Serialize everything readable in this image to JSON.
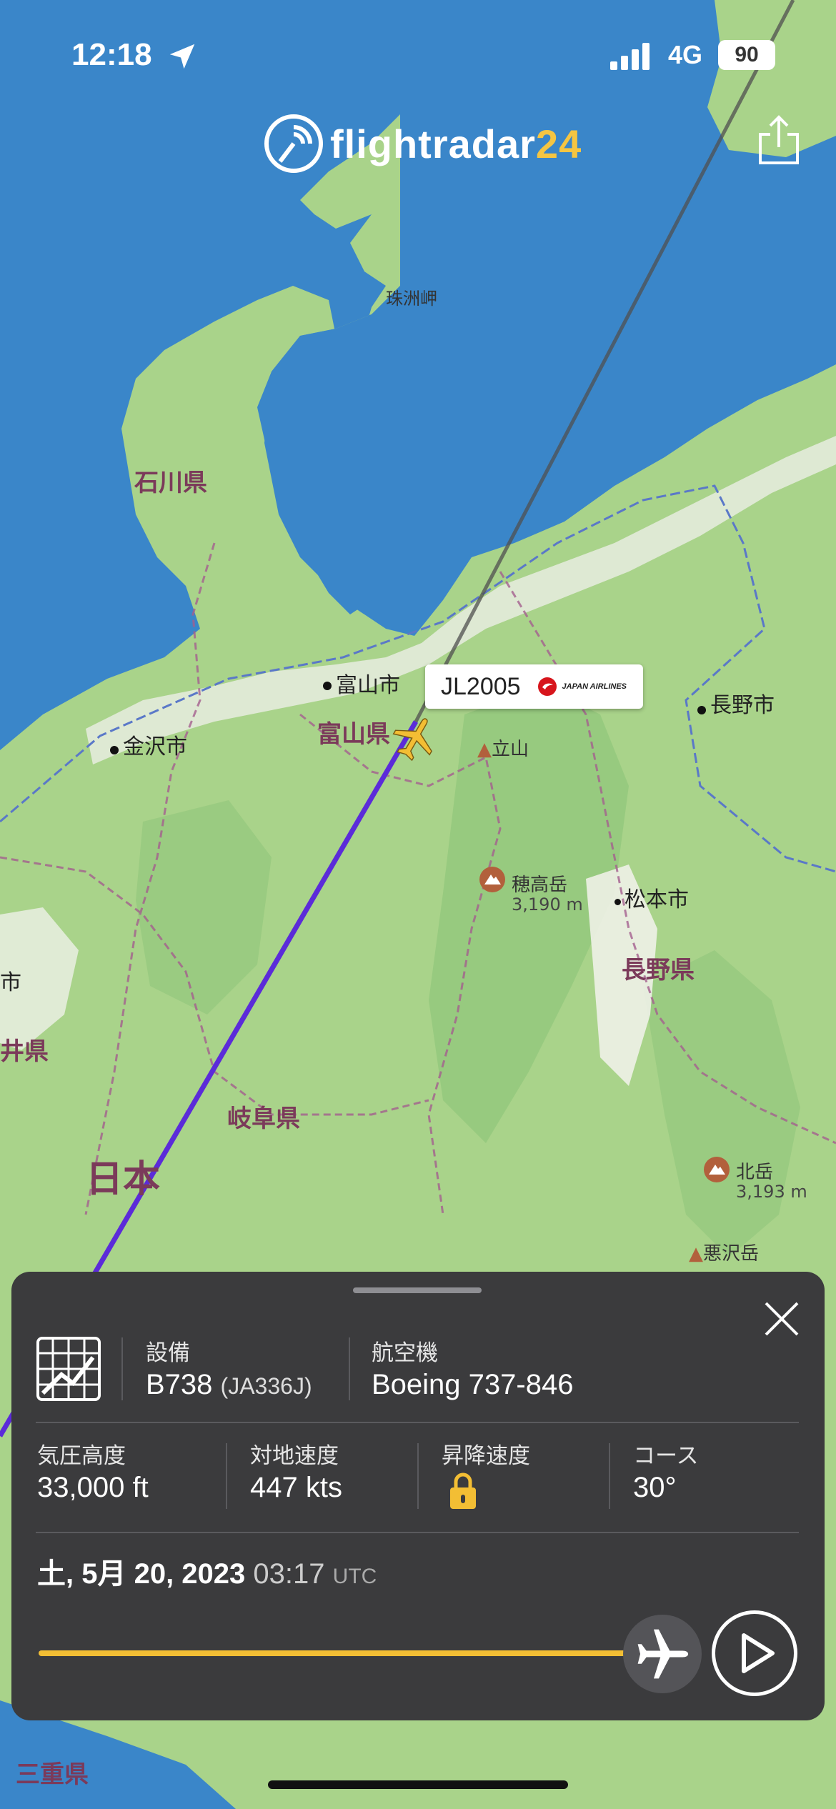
{
  "status_bar": {
    "time": "12:18",
    "network": "4G",
    "battery": "90"
  },
  "brand": {
    "name": "flightradar",
    "suffix": "24"
  },
  "map": {
    "labels": {
      "suzu": "珠洲岬",
      "ishikawa": "石川県",
      "toyama_city": "富山市",
      "toyama_pref": "富山県",
      "kanazawa": "金沢市",
      "tateyama": "立山",
      "nagano_city": "長野市",
      "hotaka": "穂高岳",
      "hotaka_elev": "3,190 m",
      "matsumoto": "松本市",
      "nagano_pref": "長野県",
      "fukui_city": "市",
      "fukui_pref": "井県",
      "gifu": "岐阜県",
      "japan": "日本",
      "kitadake": "北岳",
      "kitadake_elev": "3,193 m",
      "warusawa": "悪沢岳",
      "mie": "三重県"
    },
    "flight": {
      "callsign": "JL2005",
      "airline": "JAPAN AIRLINES"
    }
  },
  "panel": {
    "equipment_label": "設備",
    "equipment_value": "B738",
    "registration": "(JA336J)",
    "aircraft_label": "航空機",
    "aircraft_value": "Boeing 737-846",
    "altitude_label": "気圧高度",
    "altitude_value": "33,000 ft",
    "speed_label": "対地速度",
    "speed_value": "447 kts",
    "vspeed_label": "昇降速度",
    "course_label": "コース",
    "course_value": "30°",
    "date": "土, 5月 20, 2023",
    "time": "03:17",
    "tz": "UTC",
    "playback_progress": 1.0
  },
  "colors": {
    "accent": "#f3be34",
    "track": "#5b2bd9",
    "panel": "#3b3b3d"
  }
}
